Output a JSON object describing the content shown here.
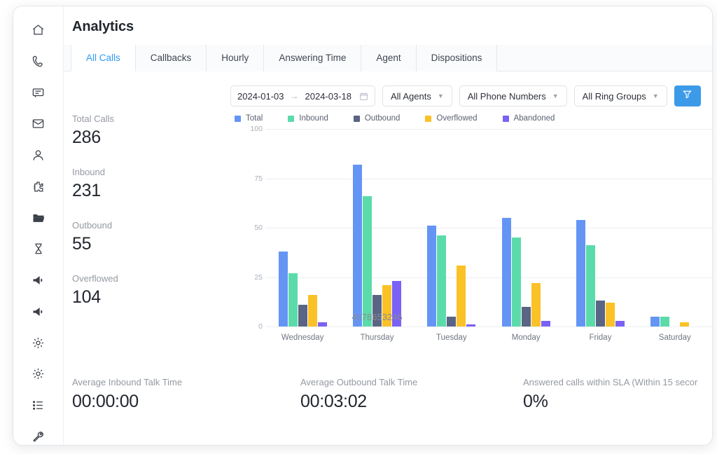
{
  "sidebar": {
    "items": [
      {
        "icon": "home-icon",
        "name": "sidebar-item-home"
      },
      {
        "icon": "phone-icon",
        "name": "sidebar-item-calls"
      },
      {
        "icon": "chat-icon",
        "name": "sidebar-item-messages"
      },
      {
        "icon": "envelope-icon",
        "name": "sidebar-item-mail"
      },
      {
        "icon": "user-icon",
        "name": "sidebar-item-contacts"
      },
      {
        "icon": "puzzle-icon",
        "name": "sidebar-item-integrations"
      },
      {
        "icon": "folder-icon",
        "name": "sidebar-item-files"
      },
      {
        "icon": "hourglass-icon",
        "name": "sidebar-item-history"
      },
      {
        "icon": "megaphone-icon",
        "name": "sidebar-item-campaigns"
      },
      {
        "icon": "megaphone-icon",
        "name": "sidebar-item-broadcasts"
      },
      {
        "icon": "gear-icon",
        "name": "sidebar-item-settings"
      },
      {
        "icon": "gear-icon",
        "name": "sidebar-item-preferences"
      },
      {
        "icon": "list-icon",
        "name": "sidebar-item-logs"
      },
      {
        "icon": "wrench-icon",
        "name": "sidebar-item-tools"
      }
    ]
  },
  "header": {
    "title": "Analytics"
  },
  "tabs": [
    {
      "label": "All Calls",
      "active": true
    },
    {
      "label": "Callbacks",
      "active": false
    },
    {
      "label": "Hourly",
      "active": false
    },
    {
      "label": "Answering Time",
      "active": false
    },
    {
      "label": "Agent",
      "active": false
    },
    {
      "label": "Dispositions",
      "active": false
    }
  ],
  "filters": {
    "date_from": "2024-01-03",
    "date_to": "2024-03-18",
    "date_separator": "→",
    "calendar_icon": "calendar-icon",
    "agents": "All Agents",
    "phone_numbers": "All Phone Numbers",
    "ring_groups": "All Ring Groups",
    "apply_icon": "funnel-icon"
  },
  "stats": [
    {
      "label": "Total Calls",
      "value": "286"
    },
    {
      "label": "Inbound",
      "value": "231"
    },
    {
      "label": "Outbound",
      "value": "55"
    },
    {
      "label": "Overflowed",
      "value": "104"
    }
  ],
  "bottom_stats": [
    {
      "label": "Average Inbound Talk Time",
      "value": "00:00:00"
    },
    {
      "label": "Average Outbound Talk Time",
      "value": "00:03:02"
    },
    {
      "label": "Answered calls within SLA (Within 15 secor",
      "value": "0%"
    }
  ],
  "chart_data": {
    "type": "bar",
    "title": "",
    "xlabel": "",
    "ylabel": "",
    "ylim": [
      0,
      100
    ],
    "yticks": [
      0,
      25,
      50,
      75,
      100
    ],
    "grid": true,
    "legend_position": "top-left",
    "categories": [
      "Wednesday",
      "Thursday",
      "Tuesday",
      "Monday",
      "Friday",
      "Saturday"
    ],
    "series": [
      {
        "name": "Total",
        "color": "#6495f5",
        "values": [
          38,
          82,
          51,
          55,
          54,
          5
        ]
      },
      {
        "name": "Inbound",
        "color": "#5bdbaa",
        "values": [
          27,
          66,
          46,
          45,
          41,
          5
        ]
      },
      {
        "name": "Outbound",
        "color": "#5a6484",
        "values": [
          11,
          16,
          5,
          10,
          13,
          0
        ]
      },
      {
        "name": "Overflowed",
        "color": "#fac227",
        "values": [
          16,
          21,
          31,
          22,
          12,
          2
        ]
      },
      {
        "name": "Abandoned",
        "color": "#7b61f5",
        "values": [
          2,
          23,
          1,
          3,
          3,
          0
        ]
      }
    ],
    "annotations": [
      {
        "text": "4678653246",
        "category": "Thursday"
      }
    ]
  }
}
